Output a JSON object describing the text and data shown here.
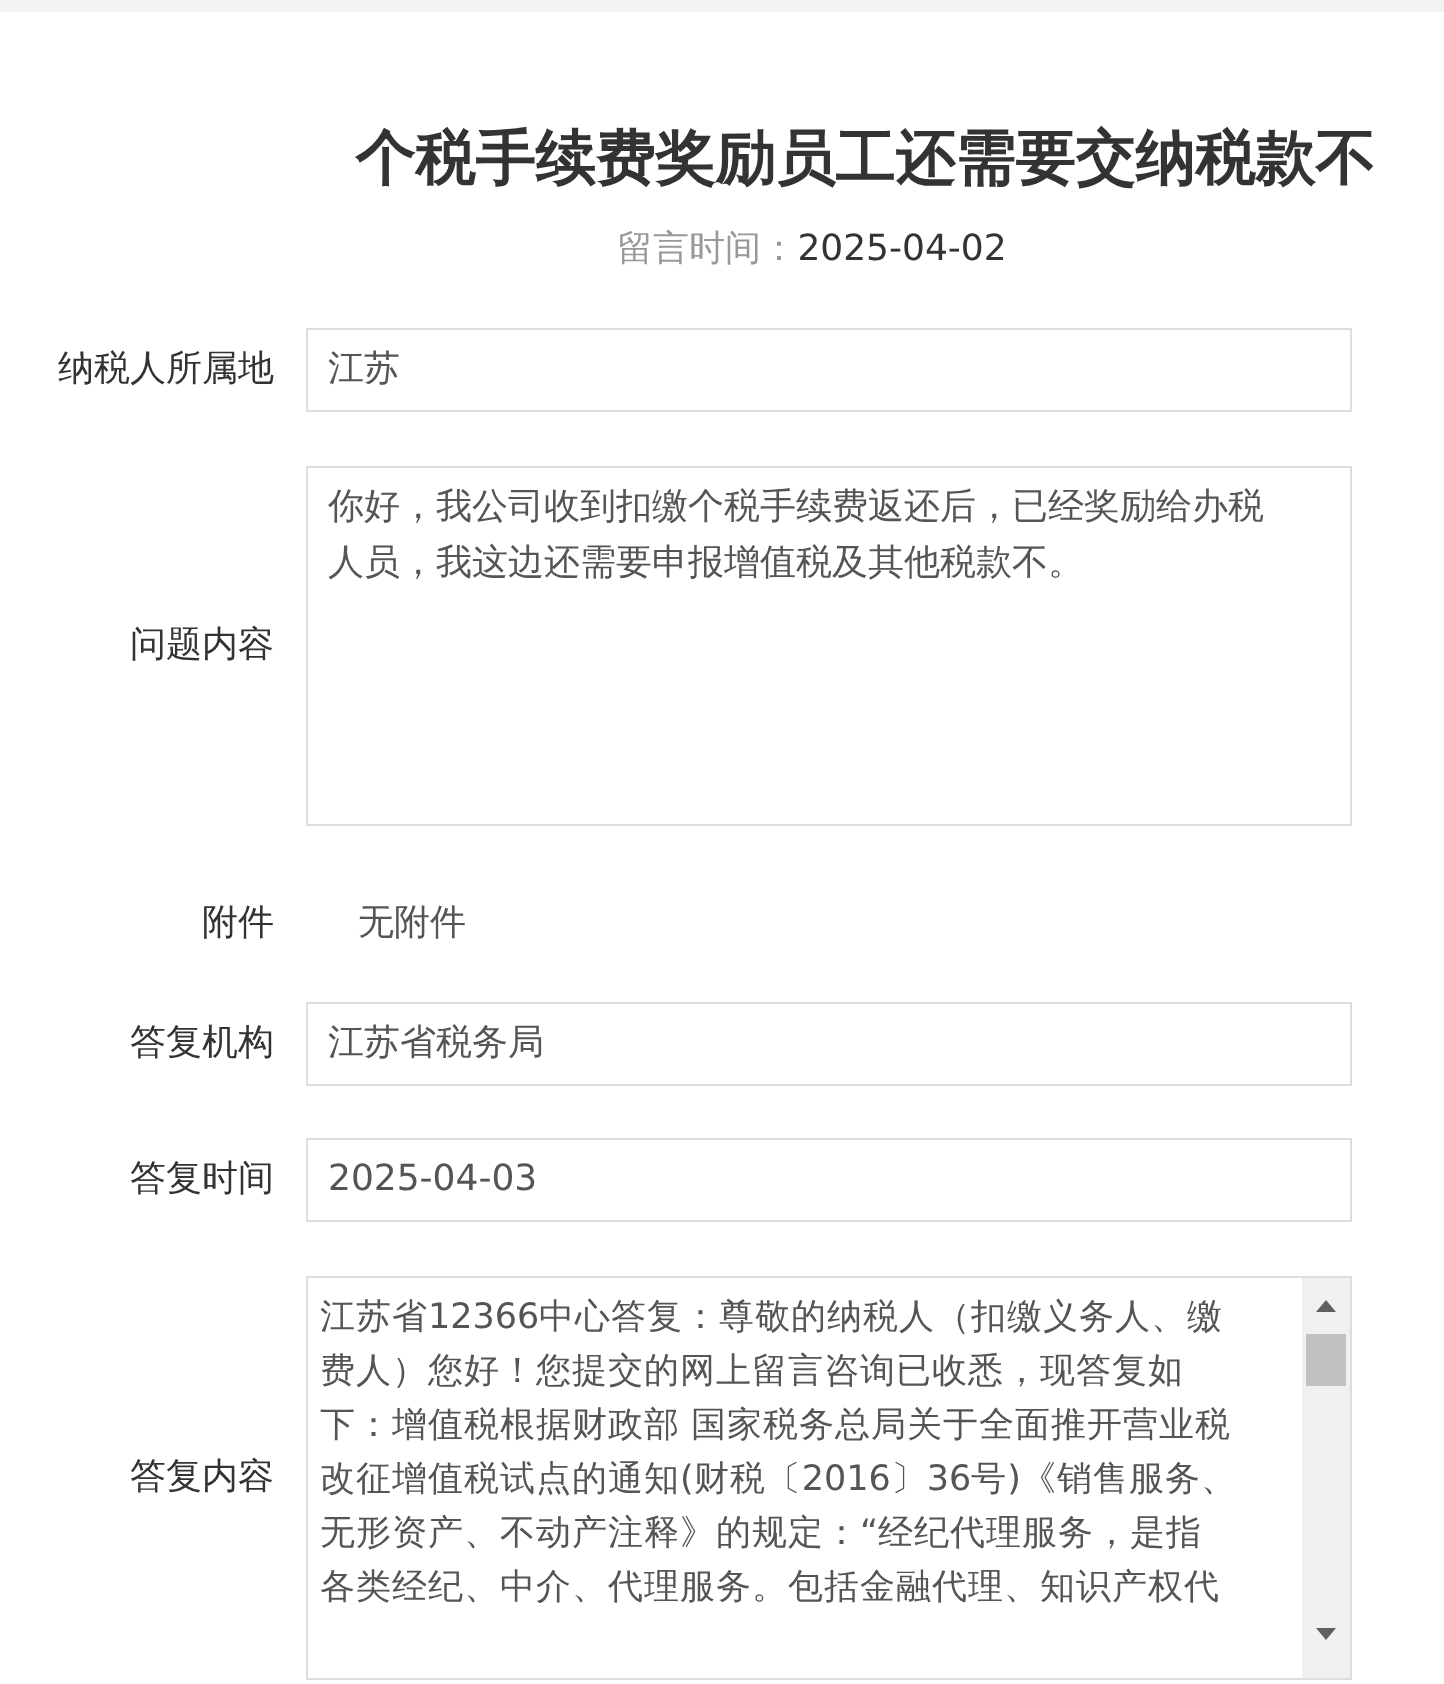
{
  "title": "个税手续费奖励员工还需要交纳税款不",
  "meta": {
    "label": "留言时间：",
    "value": "2025-04-02"
  },
  "rows": [
    {
      "kind": "field",
      "label": "纳税人所属地",
      "value": "江苏"
    },
    {
      "kind": "textarea",
      "label": "问题内容",
      "lines": [
        "你好，我公司收到扣缴个税手续费返还后，已经奖励给办税",
        "人员，我这边还需要申报增值税及其他税款不。"
      ]
    },
    {
      "kind": "text",
      "label": "附件",
      "value": "无附件"
    },
    {
      "kind": "field",
      "label": "答复机构",
      "value": "江苏省税务局"
    },
    {
      "kind": "field",
      "label": "答复时间",
      "value": "2025-04-03"
    },
    {
      "kind": "scroll-textarea",
      "label": "答复内容",
      "lines": [
        "江苏省12366中心答复：尊敬的纳税人（扣缴义务人、缴",
        "费人）您好！您提交的网上留言咨询已收悉，现答复如",
        "下：增值税根据财政部 国家税务总局关于全面推开营业税",
        "改征增值税试点的通知(财税〔2016〕36号)《销售服务、",
        "无形资产、不动产注释》的规定：“经纪代理服务，是指",
        "各类经纪、中介、代理服务。包括金融代理、知识产权代"
      ]
    }
  ]
}
